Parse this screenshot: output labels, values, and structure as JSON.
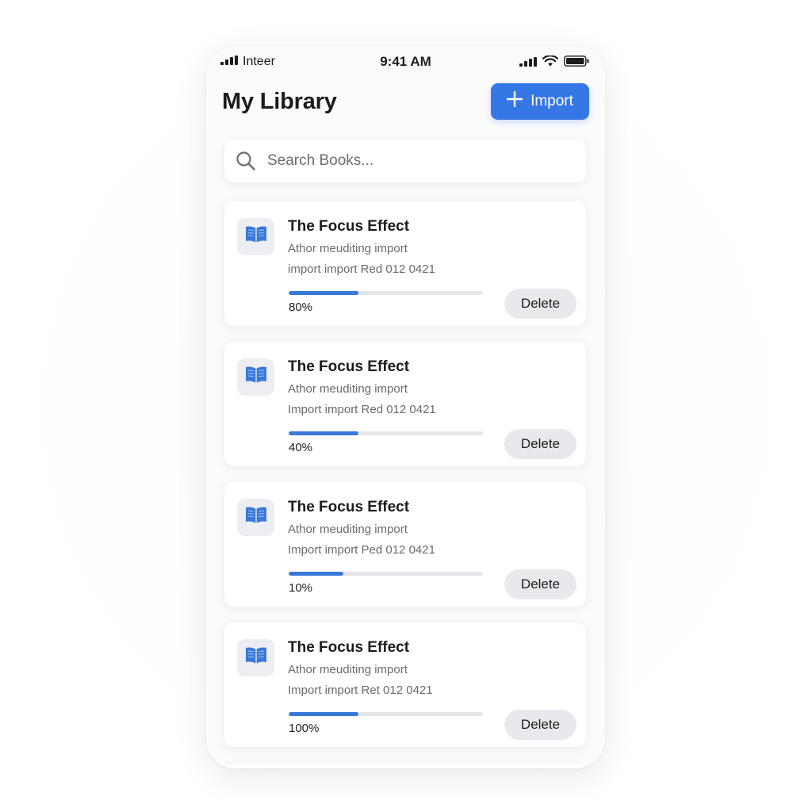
{
  "status_bar": {
    "carrier": "Inteer",
    "time": "9:41 AM"
  },
  "header": {
    "title": "My Library",
    "import_label": "Import"
  },
  "search": {
    "placeholder": "Search Books..."
  },
  "books": [
    {
      "title": "The Focus Effect",
      "meta1": "Athor meuditing import",
      "meta2": "import import Red 012 0421",
      "progress_label": "80%",
      "progress_bar_fill": 0.36,
      "delete_label": "Delete"
    },
    {
      "title": "The Focus Effect",
      "meta1": "Athor meuditing import",
      "meta2": "Import import Red 012 0421",
      "progress_label": "40%",
      "progress_bar_fill": 0.36,
      "delete_label": "Delete"
    },
    {
      "title": "The Focus Effect",
      "meta1": "Athor meuditing import",
      "meta2": "Import import Ped 012 0421",
      "progress_label": "10%",
      "progress_bar_fill": 0.28,
      "delete_label": "Delete"
    },
    {
      "title": "The Focus Effect",
      "meta1": "Athor meuditing import",
      "meta2": "Import import Ret 012 0421",
      "progress_label": "100%",
      "progress_bar_fill": 0.36,
      "delete_label": "Delete"
    }
  ],
  "colors": {
    "accent": "#3578e5",
    "progress_fill": "#3a78d8",
    "progress_track": "#e4e6ea",
    "delete_bg": "#e8e9ec",
    "thumb_bg": "#eceef2"
  },
  "icons": {
    "signal": "signal-icon",
    "wifi": "wifi-icon",
    "battery": "battery-icon",
    "plus": "plus-icon",
    "search": "search-icon",
    "book": "book-icon"
  }
}
